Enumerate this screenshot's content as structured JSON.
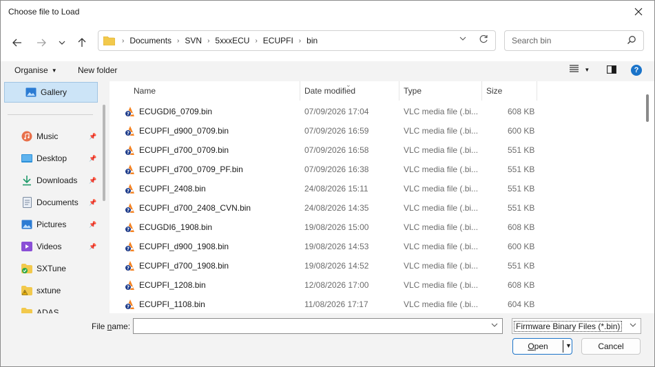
{
  "window": {
    "title": "Choose file to Load"
  },
  "address": {
    "crumbs": [
      "Documents",
      "SVN",
      "5xxxECU",
      "ECUPFI",
      "bin"
    ]
  },
  "search": {
    "placeholder": "Search bin"
  },
  "toolbar": {
    "organise": "Organise",
    "new_folder": "New folder"
  },
  "sidebar": {
    "gallery": "Gallery",
    "items": [
      {
        "label": "Music",
        "icon": "music-icon",
        "pinned": true
      },
      {
        "label": "Desktop",
        "icon": "desktop-icon",
        "pinned": true
      },
      {
        "label": "Downloads",
        "icon": "download-icon",
        "pinned": true
      },
      {
        "label": "Documents",
        "icon": "documents-icon",
        "pinned": true
      },
      {
        "label": "Pictures",
        "icon": "pictures-icon",
        "pinned": true
      },
      {
        "label": "Videos",
        "icon": "videos-icon",
        "pinned": true
      },
      {
        "label": "SXTune",
        "icon": "folder-sync-icon",
        "pinned": false
      },
      {
        "label": "sxtune",
        "icon": "folder-warning-icon",
        "pinned": false
      },
      {
        "label": "ADAS",
        "icon": "folder-icon",
        "pinned": false
      }
    ]
  },
  "columns": {
    "name": "Name",
    "date": "Date modified",
    "type": "Type",
    "size": "Size"
  },
  "files": [
    {
      "name": "ECUGDI6_0709.bin",
      "date": "07/09/2026 17:04",
      "type": "VLC media file (.bi...",
      "size": "608 KB"
    },
    {
      "name": "ECUPFI_d900_0709.bin",
      "date": "07/09/2026 16:59",
      "type": "VLC media file (.bi...",
      "size": "600 KB"
    },
    {
      "name": "ECUPFI_d700_0709.bin",
      "date": "07/09/2026 16:58",
      "type": "VLC media file (.bi...",
      "size": "551 KB"
    },
    {
      "name": "ECUPFI_d700_0709_PF.bin",
      "date": "07/09/2026 16:38",
      "type": "VLC media file (.bi...",
      "size": "551 KB"
    },
    {
      "name": "ECUPFI_2408.bin",
      "date": "24/08/2026 15:11",
      "type": "VLC media file (.bi...",
      "size": "551 KB"
    },
    {
      "name": "ECUPFI_d700_2408_CVN.bin",
      "date": "24/08/2026 14:35",
      "type": "VLC media file (.bi...",
      "size": "551 KB"
    },
    {
      "name": "ECUGDI6_1908.bin",
      "date": "19/08/2026 15:00",
      "type": "VLC media file (.bi...",
      "size": "608 KB"
    },
    {
      "name": "ECUPFI_d900_1908.bin",
      "date": "19/08/2026 14:53",
      "type": "VLC media file (.bi...",
      "size": "600 KB"
    },
    {
      "name": "ECUPFI_d700_1908.bin",
      "date": "19/08/2026 14:52",
      "type": "VLC media file (.bi...",
      "size": "551 KB"
    },
    {
      "name": "ECUPFI_1208.bin",
      "date": "12/08/2026 17:00",
      "type": "VLC media file (.bi...",
      "size": "608 KB"
    },
    {
      "name": "ECUPFI_1108.bin",
      "date": "11/08/2026 17:17",
      "type": "VLC media file (.bi...",
      "size": "604 KB"
    }
  ],
  "bottom": {
    "filename_label_pre": "File ",
    "filename_label_acc": "n",
    "filename_label_post": "ame:",
    "filename_value": "",
    "filetype": "Firmware Binary Files (*.bin)",
    "open_acc": "O",
    "open_rest": "pen",
    "cancel": "Cancel"
  },
  "colors": {
    "accent": "#1a73c9",
    "selection": "#cce4f7"
  }
}
